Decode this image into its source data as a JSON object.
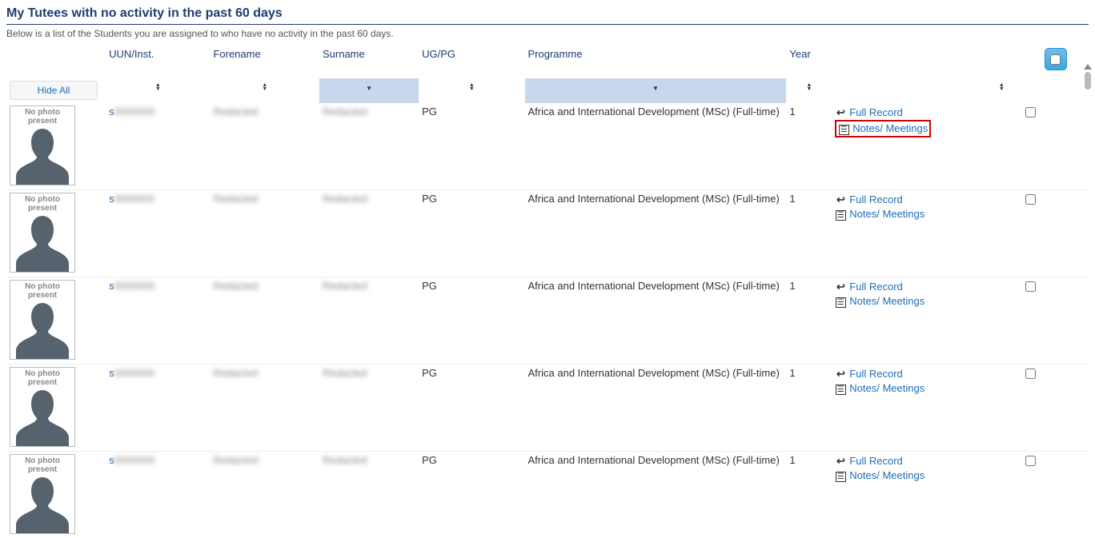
{
  "page": {
    "title": "My Tutees with no activity in the past 60 days",
    "subtitle": "Below is a list of the Students you are assigned to who have no activity in the past 60 days."
  },
  "columns": {
    "uun": "UUN/Inst.",
    "forename": "Forename",
    "surname": "Surname",
    "ugpg": "UG/PG",
    "programme": "Programme",
    "year": "Year"
  },
  "controls": {
    "hide_all": "Hide All"
  },
  "photo_placeholder": "No photo present",
  "actions": {
    "full_record": "Full Record",
    "notes_meetings": "Notes/ Meetings"
  },
  "rows": [
    {
      "uun": "s",
      "forename": "",
      "surname": "",
      "ugpg": "PG",
      "programme": "Africa and International Development (MSc) (Full-time)",
      "year": "1",
      "highlight_notes": true
    },
    {
      "uun": "s",
      "forename": "",
      "surname": "",
      "ugpg": "PG",
      "programme": "Africa and International Development (MSc) (Full-time)",
      "year": "1",
      "highlight_notes": false
    },
    {
      "uun": "s",
      "forename": "",
      "surname": "",
      "ugpg": "PG",
      "programme": "Africa and International Development (MSc) (Full-time)",
      "year": "1",
      "highlight_notes": false
    },
    {
      "uun": "s",
      "forename": "",
      "surname": "",
      "ugpg": "PG",
      "programme": "Africa and International Development (MSc) (Full-time)",
      "year": "1",
      "highlight_notes": false
    },
    {
      "uun": "s",
      "forename": "",
      "surname": "",
      "ugpg": "PG",
      "programme": "Africa and International Development (MSc) (Full-time)",
      "year": "1",
      "highlight_notes": false
    }
  ]
}
